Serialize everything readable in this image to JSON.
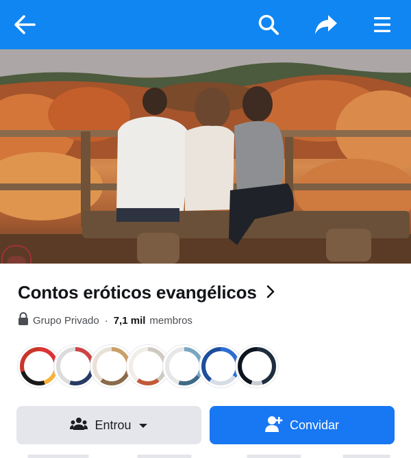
{
  "topbar": {
    "icons": [
      "back-arrow-icon",
      "search-icon",
      "share-icon",
      "menu-icon"
    ],
    "background": "#0f86f2"
  },
  "group": {
    "name": "Contos eróticos evangélicos",
    "privacy": "Grupo Privado",
    "separator": "·",
    "member_count": "7,1 mil",
    "member_label": "membros"
  },
  "avatars_count": 7,
  "buttons": {
    "joined_label": "Entrou",
    "invite_label": "Convidar"
  },
  "colors": {
    "brand_blue": "#1877f2",
    "title": "#111418",
    "secondary_button": "#e4e6eb"
  }
}
